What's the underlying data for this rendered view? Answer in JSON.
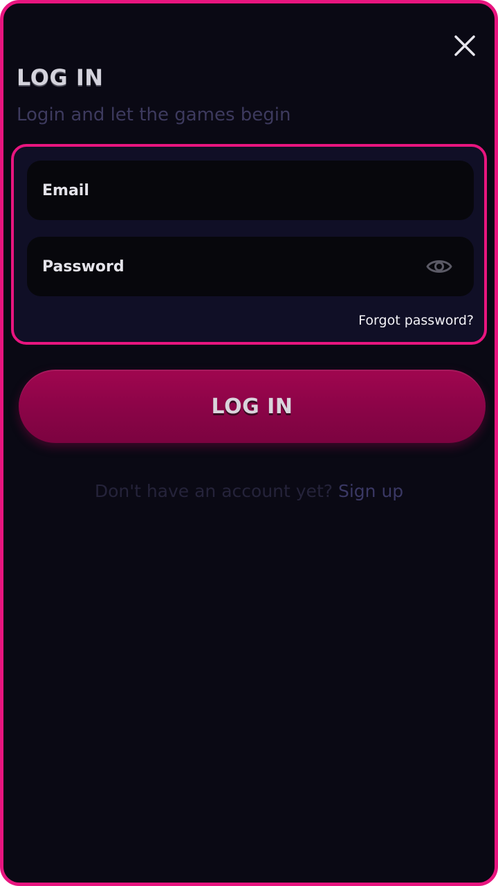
{
  "dialog": {
    "title": "LOG IN",
    "subtitle": "Login and let the games begin"
  },
  "form": {
    "email_placeholder": "Email",
    "email_value": "",
    "password_placeholder": "Password",
    "password_value": "",
    "forgot_label": "Forgot password?"
  },
  "actions": {
    "login_label": "LOG IN",
    "signup_prompt": "Don't have an account yet?",
    "signup_label": "Sign up"
  },
  "icons": {
    "close": "close-icon",
    "password_toggle": "eye-icon"
  },
  "colors": {
    "accent": "#e8157f",
    "button": "#8a0447",
    "background": "#0a0914",
    "form_panel": "#100f26",
    "field": "#07070c"
  }
}
